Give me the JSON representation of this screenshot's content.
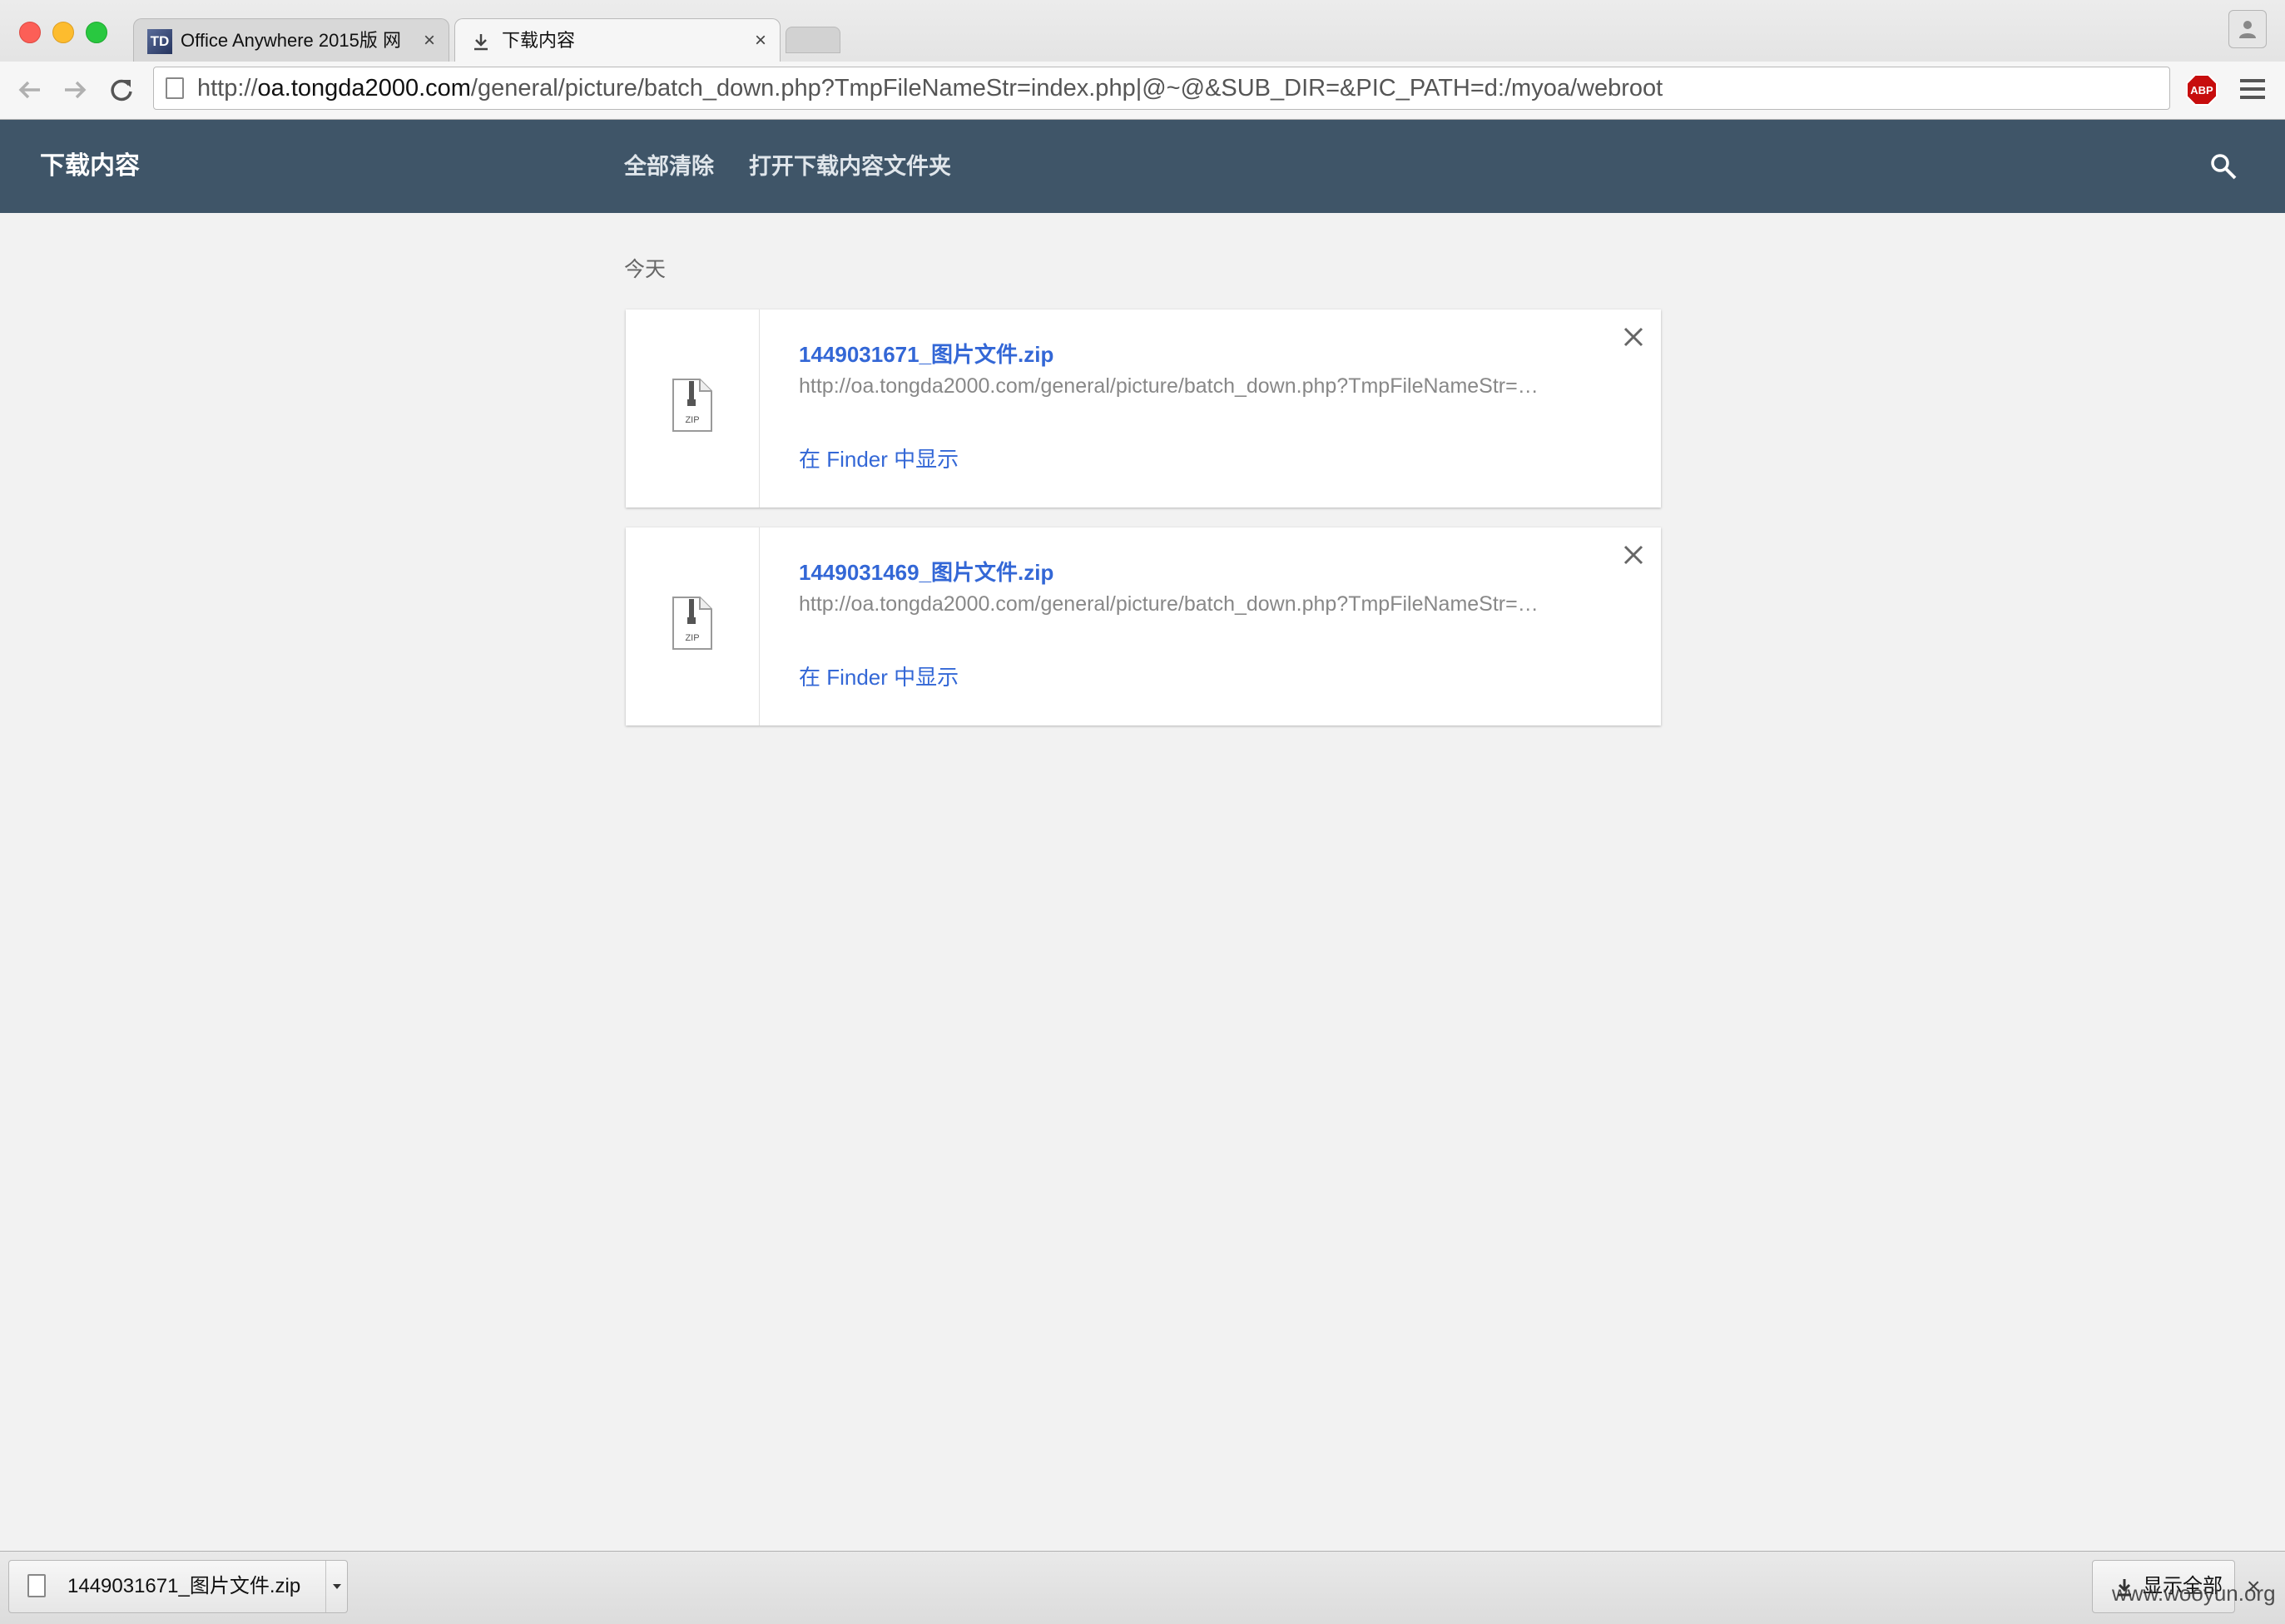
{
  "tabs": [
    {
      "favicon_text": "TD",
      "title": "Office Anywhere 2015版 网",
      "close": "×"
    },
    {
      "title": "下载内容",
      "close": "×"
    }
  ],
  "address_bar": {
    "scheme": "http://",
    "host": "oa.tongda2000.com",
    "path": "/general/picture/batch_down.php?TmpFileNameStr=index.php|@~@&SUB_DIR=&PIC_PATH=d:/myoa/webroot"
  },
  "extension": {
    "label": "ABP",
    "color": "#c70d0d"
  },
  "header": {
    "title": "下载内容",
    "actions": {
      "clear_all": "全部清除",
      "open_folder": "打开下载内容文件夹"
    },
    "background": "#3f5568"
  },
  "section": {
    "date_label": "今天"
  },
  "downloads": [
    {
      "file_name": "1449031671_图片文件.zip",
      "url": "http://oa.tongda2000.com/general/picture/batch_down.php?TmpFileNameStr=…",
      "action": "在 Finder 中显示",
      "icon_text": "ZIP"
    },
    {
      "file_name": "1449031469_图片文件.zip",
      "url": "http://oa.tongda2000.com/general/picture/batch_down.php?TmpFileNameStr=…",
      "action": "在 Finder 中显示",
      "icon_text": "ZIP"
    }
  ],
  "shelf": {
    "item_file_name": "1449031671_图片文件.zip",
    "show_all": "显示全部",
    "close": "×"
  },
  "watermark": "www.wooyun.org",
  "colors": {
    "link": "#3367d6",
    "muted": "#888888"
  }
}
